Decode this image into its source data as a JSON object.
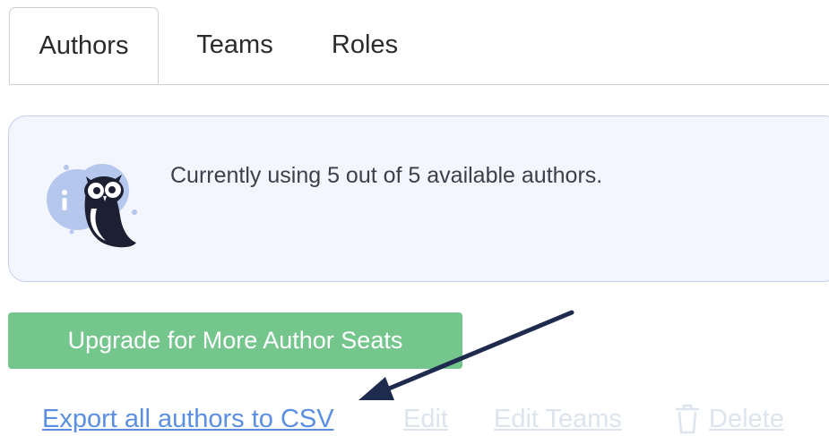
{
  "tabs": [
    {
      "label": "Authors",
      "active": true
    },
    {
      "label": "Teams",
      "active": false
    },
    {
      "label": "Roles",
      "active": false
    }
  ],
  "info": {
    "icon": "owl-info-icon",
    "message": "Currently using 5 out of 5 available authors."
  },
  "upgrade": {
    "label": "Upgrade for More Author Seats",
    "color": "#74c68d"
  },
  "actions": {
    "export_label": "Export all authors to CSV",
    "edit_label": "Edit",
    "edit_teams_label": "Edit Teams",
    "delete_label": "Delete",
    "delete_icon": "trash-icon"
  },
  "colors": {
    "link": "#5b8fe3",
    "disabled_link": "#dde4ee",
    "info_bg": "#f3f6fe",
    "arrow": "#1f2a4f"
  }
}
